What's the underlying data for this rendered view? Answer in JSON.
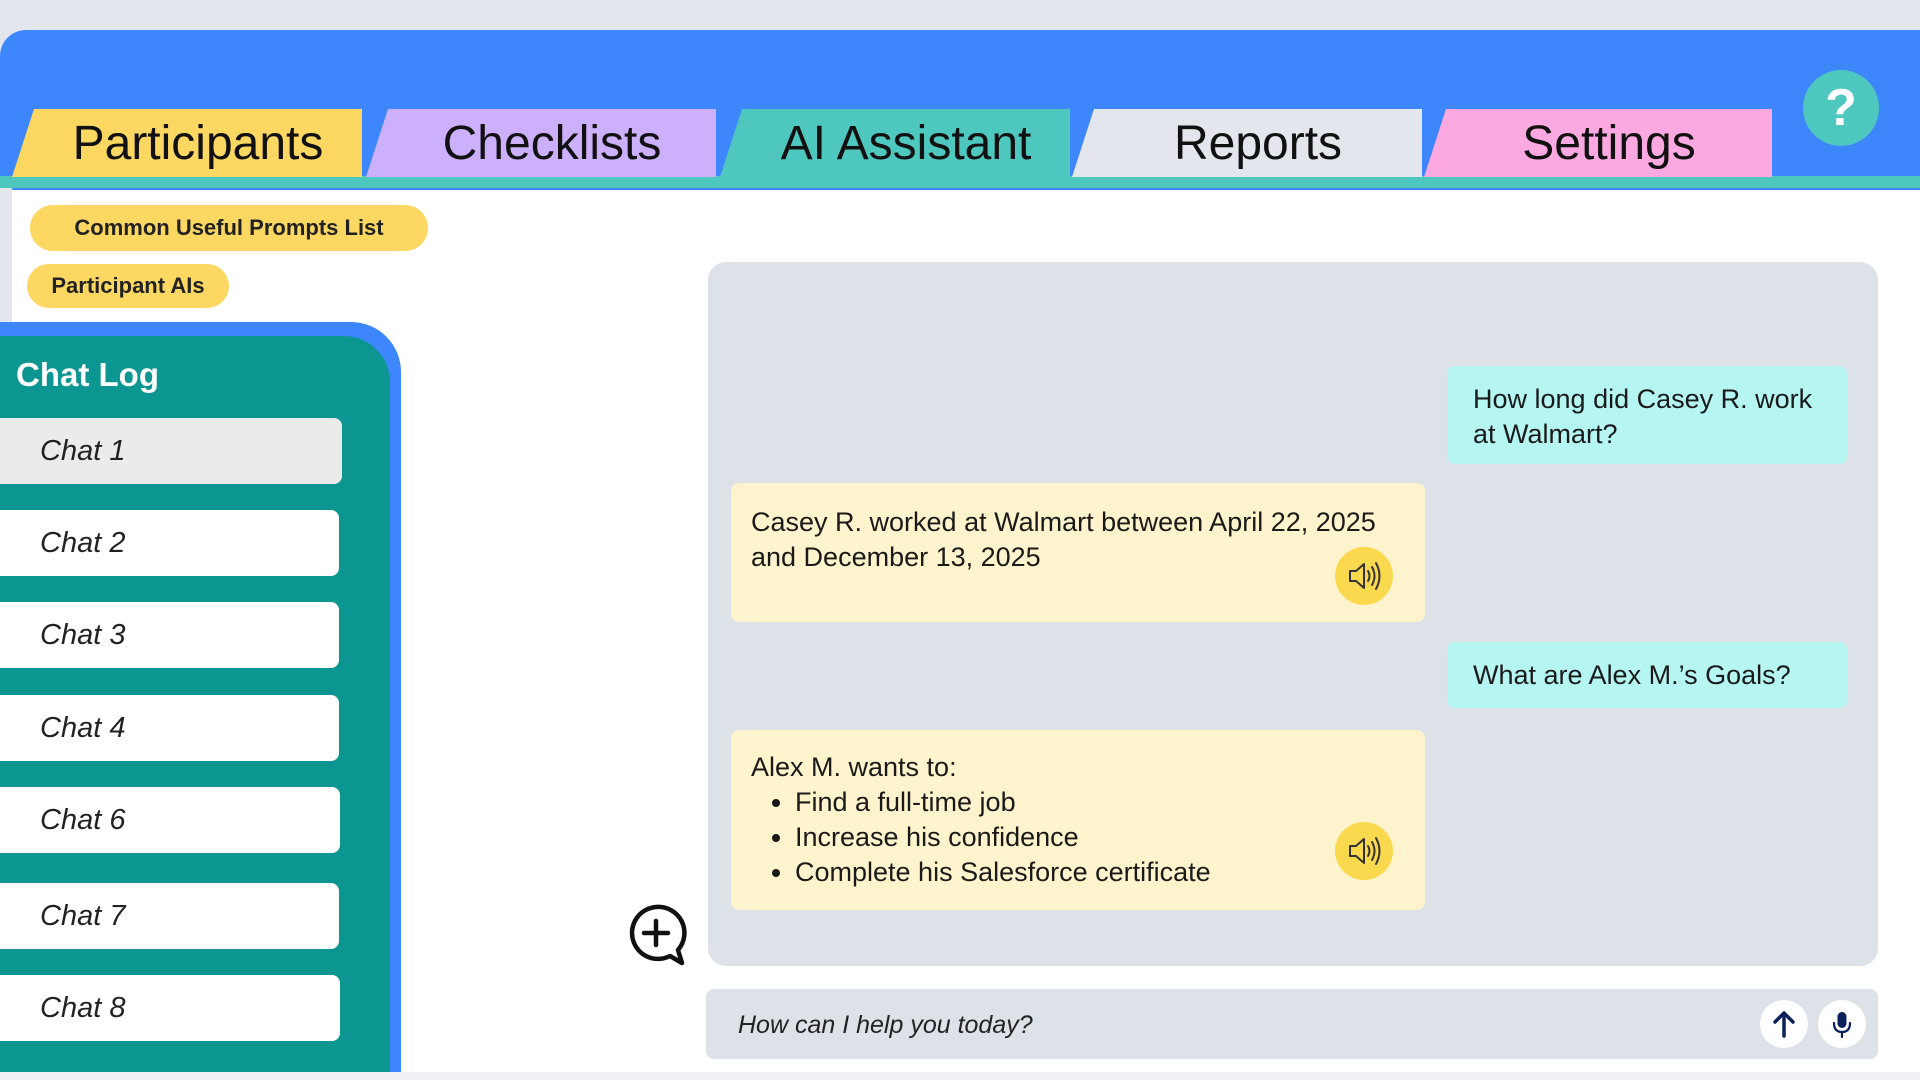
{
  "colors": {
    "header_blue": "#3d86fb",
    "teal": "#4ec8bf",
    "dark_teal": "#0c9691",
    "yellow": "#fcd862",
    "user_bubble": "#b5f5f2",
    "ai_bubble": "#fdf3cc"
  },
  "tabs": [
    {
      "label": "Participants",
      "color": "#fcd862",
      "active": true
    },
    {
      "label": "Checklists",
      "color": "#cdb0fc"
    },
    {
      "label": "AI Assistant",
      "color": "#4ec8bf"
    },
    {
      "label": "Reports",
      "color": "#e3e6ec"
    },
    {
      "label": "Settings",
      "color": "#fba9e0"
    }
  ],
  "help": {
    "label": "?",
    "icon": "question-icon"
  },
  "side_buttons": {
    "prompts": "Common Useful Prompts List",
    "participant_ais": "Participant AIs"
  },
  "chat_log": {
    "title": "Chat Log",
    "items": [
      {
        "label": "Chat 1",
        "active": true
      },
      {
        "label": "Chat 2"
      },
      {
        "label": "Chat 3"
      },
      {
        "label": "Chat 4"
      },
      {
        "label": "Chat 6"
      },
      {
        "label": "Chat 7"
      },
      {
        "label": "Chat 8"
      }
    ]
  },
  "conversation": {
    "messages": [
      {
        "role": "user",
        "text": "How long did Casey R. work at Walmart?"
      },
      {
        "role": "assistant",
        "text": "Casey R. worked at Walmart between April 22, 2025 and December 13, 2025",
        "icon": "speaker-icon"
      },
      {
        "role": "user",
        "text": "What are Alex M.’s Goals?"
      },
      {
        "role": "assistant",
        "intro": "Alex M. wants to:",
        "bullets": [
          "Find a full-time job",
          "Increase his confidence",
          "Complete his Salesforce certificate"
        ],
        "icon": "speaker-icon"
      }
    ]
  },
  "input": {
    "placeholder": "How can I help you today?",
    "send_icon": "arrow-up-icon",
    "mic_icon": "microphone-icon"
  },
  "new_chat_icon": "chat-plus-icon"
}
